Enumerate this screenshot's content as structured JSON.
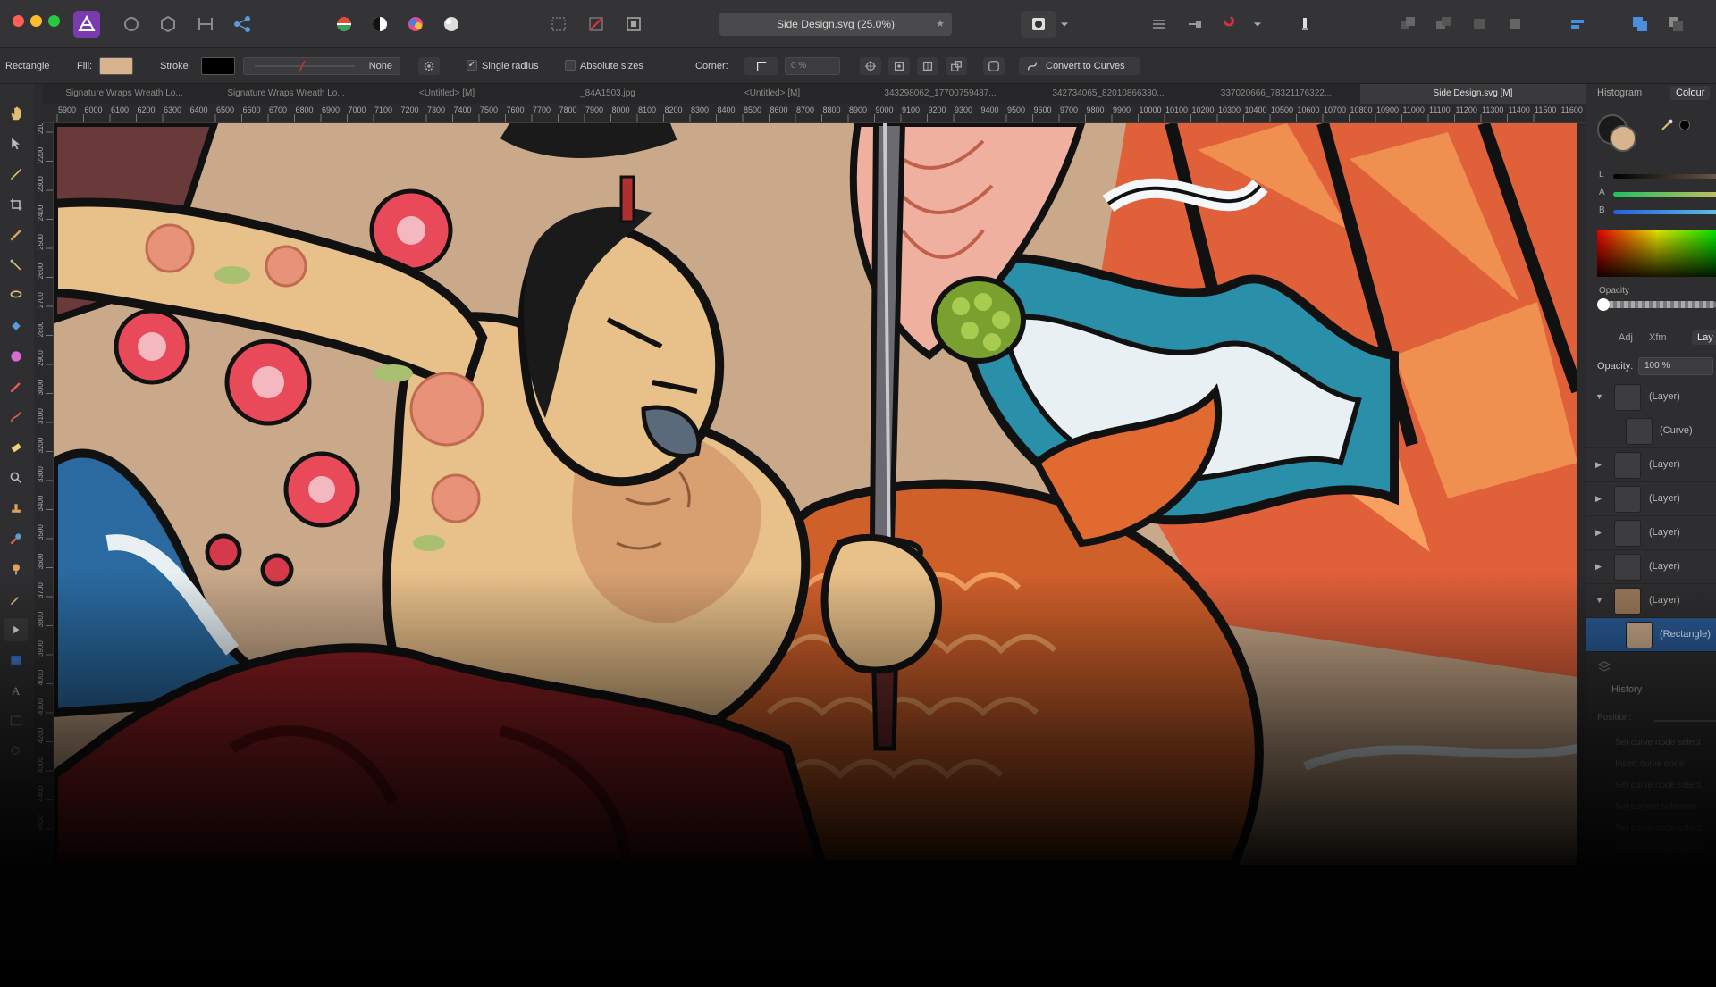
{
  "toolbar": {
    "document_title": "Side Design.svg (25.0%)",
    "title_star": "★"
  },
  "context": {
    "tool_name": "Rectangle",
    "fill_label": "Fill:",
    "stroke_label": "Stroke",
    "stroke_style": "None",
    "single_radius_label": "Single radius",
    "single_radius_checked": "✓",
    "absolute_sizes_label": "Absolute sizes",
    "corner_label": "Corner:",
    "corner_value": "0 %",
    "convert_label": "Convert to Curves",
    "fill_color": "#d7b38e",
    "stroke_color": "#000000"
  },
  "tabs": [
    {
      "label": "Signature Wraps Wreath Lo..."
    },
    {
      "label": "Signature Wraps Wreath Lo..."
    },
    {
      "label": "<Untitled> [M]"
    },
    {
      "label": "_84A1503.jpg"
    },
    {
      "label": "<Untitled> [M]"
    },
    {
      "label": "343298062_17700759487..."
    },
    {
      "label": "342734065_82010866330..."
    },
    {
      "label": "337020666_78321176322..."
    },
    {
      "label": "Side Design.svg [M]"
    }
  ],
  "ruler": {
    "labels": [
      "5900",
      "6000",
      "6100",
      "6200",
      "6300",
      "6400",
      "6500",
      "6600",
      "6700",
      "6800",
      "6900",
      "7000",
      "7100",
      "7200",
      "7300",
      "7400",
      "7500",
      "7600",
      "7700",
      "7800",
      "7900",
      "8000",
      "8100",
      "8200",
      "8300",
      "8400",
      "8500",
      "8600",
      "8700",
      "8800",
      "8900",
      "9000",
      "9100",
      "9200",
      "9300",
      "9400",
      "9500",
      "9600",
      "9700",
      "9800",
      "9900",
      "10000",
      "10100",
      "10200",
      "10300",
      "10400",
      "10500",
      "10600",
      "10700",
      "10800",
      "10900",
      "11000",
      "11100",
      "11200",
      "11300",
      "11400",
      "11500",
      "11600"
    ],
    "vertical_labels": [
      "2100",
      "2200",
      "2300",
      "2400",
      "2500",
      "2600",
      "2700",
      "2800",
      "2900",
      "3000",
      "3100",
      "3200",
      "3300",
      "3400",
      "3500",
      "3600",
      "3700",
      "3800",
      "3900",
      "4000",
      "4100",
      "4200",
      "4300",
      "4400",
      "4500"
    ]
  },
  "panel": {
    "tabs": {
      "histogram": "Histogram",
      "colour": "Colour"
    },
    "slider_labels": {
      "l": "L",
      "a": "A",
      "b": "B"
    },
    "opacity_label": "Opacity",
    "sub_tabs": {
      "adj": "Adj",
      "xfm": "Xfm",
      "layers": "Lay"
    },
    "layer_opacity_label": "Opacity:",
    "layer_opacity_value": "100 %",
    "layers": [
      {
        "name": "(Layer)"
      },
      {
        "name": "(Curve)"
      },
      {
        "name": "(Layer)"
      },
      {
        "name": "(Layer)"
      },
      {
        "name": "(Layer)"
      },
      {
        "name": "(Layer)"
      },
      {
        "name": "(Layer)"
      },
      {
        "name": "(Rectangle)"
      }
    ],
    "history_label": "History",
    "position_label": "Position:",
    "history_items": [
      "Set curve node select",
      "Insert curve node",
      "Set curve node select",
      "Set current selection",
      "Set curve node select",
      "Set curve node select"
    ]
  },
  "colors": {
    "primary": "#1a1a1a",
    "secondary": "#d7b38e",
    "accent_selected_layer": "#2a5b96"
  }
}
